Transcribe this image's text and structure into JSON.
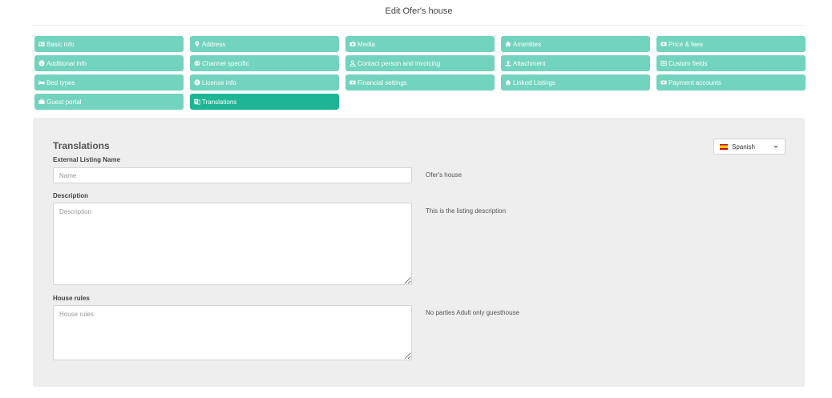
{
  "page": {
    "title": "Edit Ofer's house"
  },
  "tabs": [
    {
      "label": "Basic info",
      "icon": "id-card-icon"
    },
    {
      "label": "Address",
      "icon": "map-marker-icon"
    },
    {
      "label": "Media",
      "icon": "camera-icon"
    },
    {
      "label": "Amenities",
      "icon": "home-icon"
    },
    {
      "label": "Price & fees",
      "icon": "money-icon"
    },
    {
      "label": "Additional info",
      "icon": "info-circle-icon"
    },
    {
      "label": "Channel specific",
      "icon": "globe-icon"
    },
    {
      "label": "Contact person and invoicing",
      "icon": "user-icon"
    },
    {
      "label": "Attachment",
      "icon": "upload-icon"
    },
    {
      "label": "Custom fields",
      "icon": "grid-icon"
    },
    {
      "label": "Bed types",
      "icon": "bed-icon"
    },
    {
      "label": "License info",
      "icon": "info-circle-icon"
    },
    {
      "label": "Financial settings",
      "icon": "money-icon"
    },
    {
      "label": "Linked Listings",
      "icon": "home-icon"
    },
    {
      "label": "Payment accounts",
      "icon": "money-icon"
    },
    {
      "label": "Guest portal",
      "icon": "briefcase-icon"
    },
    {
      "label": "Translations",
      "icon": "translate-icon",
      "active": true
    }
  ],
  "colors": {
    "tab": "#72d3be",
    "tab_active": "#1db594",
    "panel": "#eeeeee"
  },
  "translations": {
    "title": "Translations",
    "language": "Spanish",
    "language_icon": "spain-flag-icon",
    "fields": {
      "name": {
        "label": "External Listing Name",
        "placeholder": "Name",
        "value": "",
        "original": "Ofer's house"
      },
      "description": {
        "label": "Description",
        "placeholder": "Description",
        "value": "",
        "original": "This is the listing description"
      },
      "house_rules": {
        "label": "House rules",
        "placeholder": "House rules",
        "value": "",
        "original": "No parties Adult only guesthouse"
      }
    }
  }
}
